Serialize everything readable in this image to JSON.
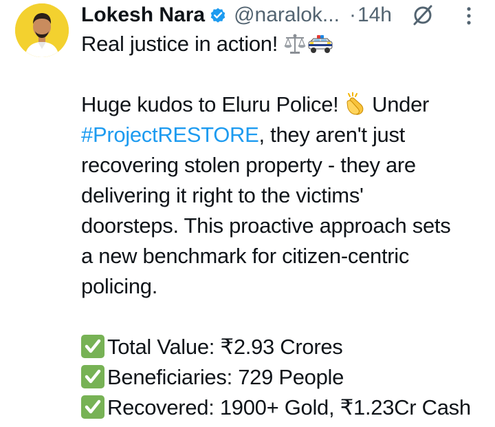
{
  "author": {
    "name": "Lokesh Nara",
    "handle": "@naralok...",
    "separator": "·",
    "time": "14h"
  },
  "icons": {
    "verified": "verified-badge-icon",
    "grok": "grok-icon",
    "more": "more-vertical-icon",
    "scales": "balance-scale-emoji",
    "police_car": "police-car-emoji",
    "clap": "clapping-hands-emoji",
    "check": "check-mark-emoji"
  },
  "colors": {
    "hashtag": "#1d9bf0",
    "verified": "#1d9bf0",
    "secondary_text": "#536471",
    "check_box": "#77b255"
  },
  "post": {
    "line1": "Real justice in action!",
    "line2_a": "Huge kudos to Eluru Police!",
    "line2_b": "Under",
    "hashtag": "#ProjectRESTORE",
    "line3_rest": ", they aren't just",
    "line4": "recovering stolen property - they are",
    "line5": "delivering it right to the victims'",
    "line6": "doorsteps. This proactive approach sets",
    "line7": "a new benchmark for citizen-centric",
    "line8": "policing.",
    "stat1": "Total Value: ₹2.93 Crores",
    "stat2": "Beneficiaries: 729 People",
    "stat3": "Recovered: 1900+ Gold, ₹1.23Cr Cash"
  }
}
